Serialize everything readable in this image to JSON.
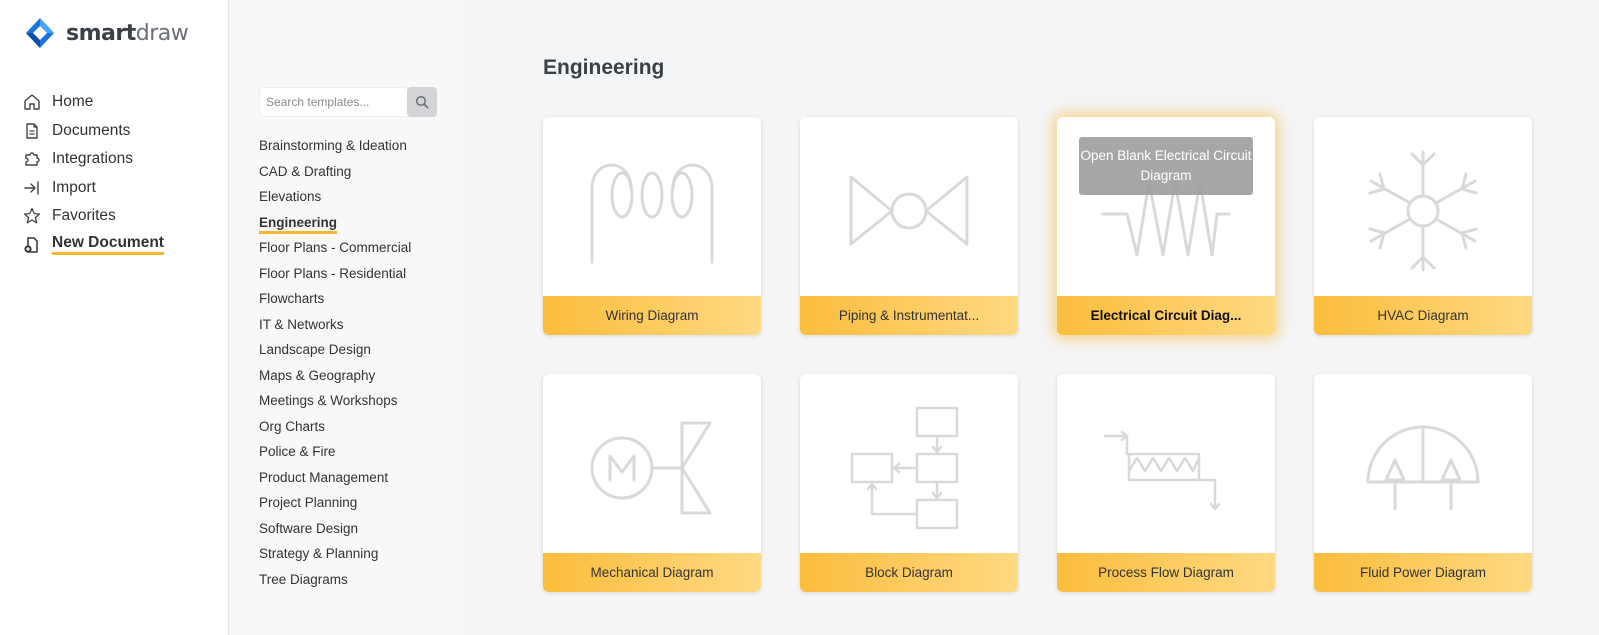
{
  "app": {
    "brand_bold": "smart",
    "brand_light": "draw"
  },
  "nav": {
    "items": [
      {
        "label": "Home",
        "icon": "home-icon"
      },
      {
        "label": "Documents",
        "icon": "document-icon"
      },
      {
        "label": "Integrations",
        "icon": "puzzle-icon"
      },
      {
        "label": "Import",
        "icon": "import-icon"
      },
      {
        "label": "Favorites",
        "icon": "star-icon"
      },
      {
        "label": "New Document",
        "icon": "new-document-icon",
        "active": true
      }
    ]
  },
  "search": {
    "placeholder": "Search templates..."
  },
  "categories": [
    "Brainstorming & Ideation",
    "CAD & Drafting",
    "Elevations",
    "Engineering",
    "Floor Plans - Commercial",
    "Floor Plans - Residential",
    "Flowcharts",
    "IT & Networks",
    "Landscape Design",
    "Maps & Geography",
    "Meetings & Workshops",
    "Org Charts",
    "Police & Fire",
    "Product Management",
    "Project Planning",
    "Software Design",
    "Strategy & Planning",
    "Tree Diagrams"
  ],
  "active_category": "Engineering",
  "main": {
    "title": "Engineering",
    "cards": [
      {
        "label": "Wiring Diagram"
      },
      {
        "label": "Piping & Instrumentat..."
      },
      {
        "label": "Electrical Circuit Diag...",
        "tooltip": "Open Blank Electrical Circuit Diagram"
      },
      {
        "label": "HVAC Diagram"
      },
      {
        "label": "Mechanical Diagram"
      },
      {
        "label": "Block Diagram"
      },
      {
        "label": "Process Flow Diagram"
      },
      {
        "label": "Fluid Power Diagram"
      }
    ]
  },
  "colors": {
    "accent": "#f7b631",
    "caption_start": "#fbbd3c",
    "caption_end": "#ffd983",
    "logo_blue": "#1a73d9"
  }
}
